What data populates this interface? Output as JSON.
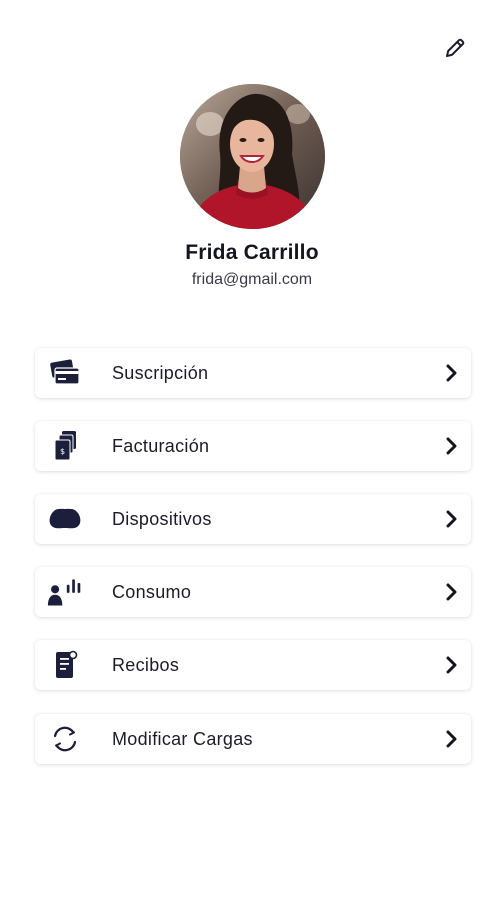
{
  "header": {
    "edit_icon": "pencil-icon"
  },
  "profile": {
    "name": "Frida Carrillo",
    "email": "frida@gmail.com",
    "avatar": "profile-photo"
  },
  "menu": {
    "items": [
      {
        "label": "Suscripción",
        "icon": "credit-card-icon"
      },
      {
        "label": "Facturación",
        "icon": "invoice-stack-icon"
      },
      {
        "label": "Dispositivos",
        "icon": "device-icon"
      },
      {
        "label": "Consumo",
        "icon": "user-consumption-icon"
      },
      {
        "label": "Recibos",
        "icon": "receipt-icon"
      },
      {
        "label": "Modificar Cargas",
        "icon": "refresh-icon"
      }
    ],
    "chevron_icon": "chevron-right-icon"
  },
  "colors": {
    "icon_navy": "#1b1f3b",
    "text": "#1c1c28",
    "card_bg": "#ffffff"
  }
}
